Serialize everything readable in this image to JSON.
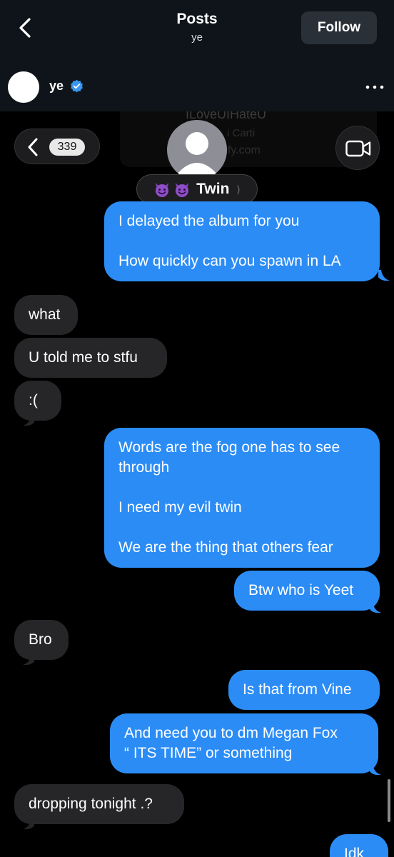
{
  "header": {
    "title": "Posts",
    "subtitle": "ye",
    "follow_label": "Follow"
  },
  "post": {
    "username": "ye",
    "verified": true
  },
  "link_preview": {
    "title": "ILoveUIHateU",
    "artist": "i Carti",
    "source": "otify.com"
  },
  "conversation": {
    "unread_count": "339",
    "contact_name": "Twin",
    "contact_emoji": [
      "😈",
      "😈"
    ]
  },
  "messages": [
    {
      "side": "out",
      "text": "I delayed the album for you\n\nHow quickly can you spawn in LA"
    },
    {
      "side": "in",
      "text": "what"
    },
    {
      "side": "in",
      "text": "U told me to stfu"
    },
    {
      "side": "in",
      "text": ":("
    },
    {
      "side": "out",
      "text": "Words are the fog one has to see through\n\nI need my evil twin\n\nWe are the thing that others fear"
    },
    {
      "side": "out",
      "text": "Btw who is Yeet"
    },
    {
      "side": "in",
      "text": "Bro"
    },
    {
      "side": "out",
      "text": "Is that from Vine"
    },
    {
      "side": "out",
      "text": "And need you to dm Megan Fox\n“ ITS TIME” or something"
    },
    {
      "side": "in",
      "text": "dropping tonight .?"
    },
    {
      "side": "out",
      "text": "Idk"
    }
  ],
  "colors": {
    "outgoing_bubble": "#2b8cf6",
    "incoming_bubble": "#262628",
    "header_bg": "#0f141a",
    "verified": "#3897f0"
  }
}
